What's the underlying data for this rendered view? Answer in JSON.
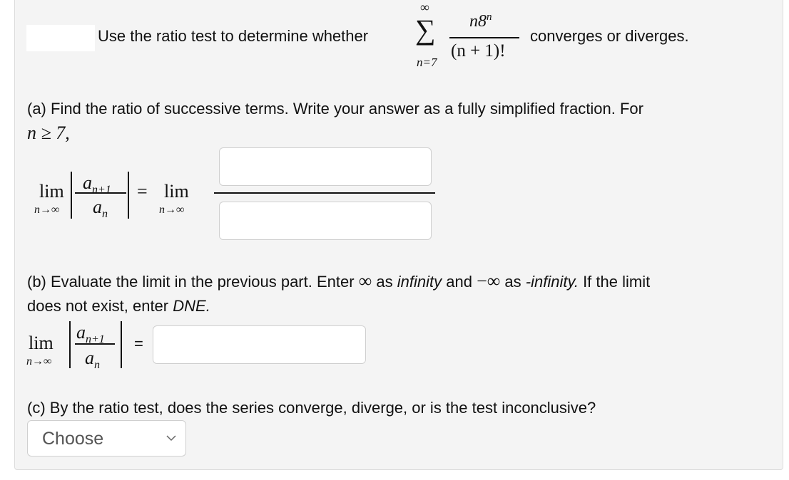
{
  "question": {
    "intro_text": "Use the ratio test to determine whether",
    "series": {
      "sum_symbol": "∑",
      "upper_limit": "∞",
      "lower_limit": "n=7",
      "numerator_base": "n8",
      "numerator_exponent": "n",
      "denominator": "(n + 1)!"
    },
    "outro_text": "converges or diverges."
  },
  "part_a": {
    "prompt": "(a) Find the ratio of successive terms. Write your answer as a fully simplified fraction. For",
    "condition": "n ≥ 7,",
    "lim": "lim",
    "lim_sub": "n→∞",
    "ratio_num": "a",
    "ratio_num_sub": "n+1",
    "ratio_den": "a",
    "ratio_den_sub": "n",
    "equals": "=",
    "numerator_input": {
      "value": "",
      "placeholder": ""
    },
    "denominator_input": {
      "value": "",
      "placeholder": ""
    }
  },
  "part_b": {
    "prompt_1": "(b) Evaluate the limit in the previous part. Enter",
    "infinity_symbol": "∞",
    "as_1": "as",
    "infinity_word": "infinity",
    "and": "and",
    "neg_infinity_symbol": "−∞",
    "as_2": "as",
    "neg_infinity_word": "-infinity.",
    "prompt_2": "If the limit",
    "prompt_3": "does not exist, enter",
    "dne": "DNE.",
    "lim": "lim",
    "lim_sub": "n→∞",
    "ratio_num": "a",
    "ratio_num_sub": "n+1",
    "ratio_den": "a",
    "ratio_den_sub": "n",
    "equals": "=",
    "answer_input": {
      "value": "",
      "placeholder": ""
    }
  },
  "part_c": {
    "prompt": "(c) By the ratio test, does the series converge, diverge, or is the test inconclusive?",
    "select": {
      "selected": "Choose",
      "icon": "chevron-down-icon"
    }
  }
}
